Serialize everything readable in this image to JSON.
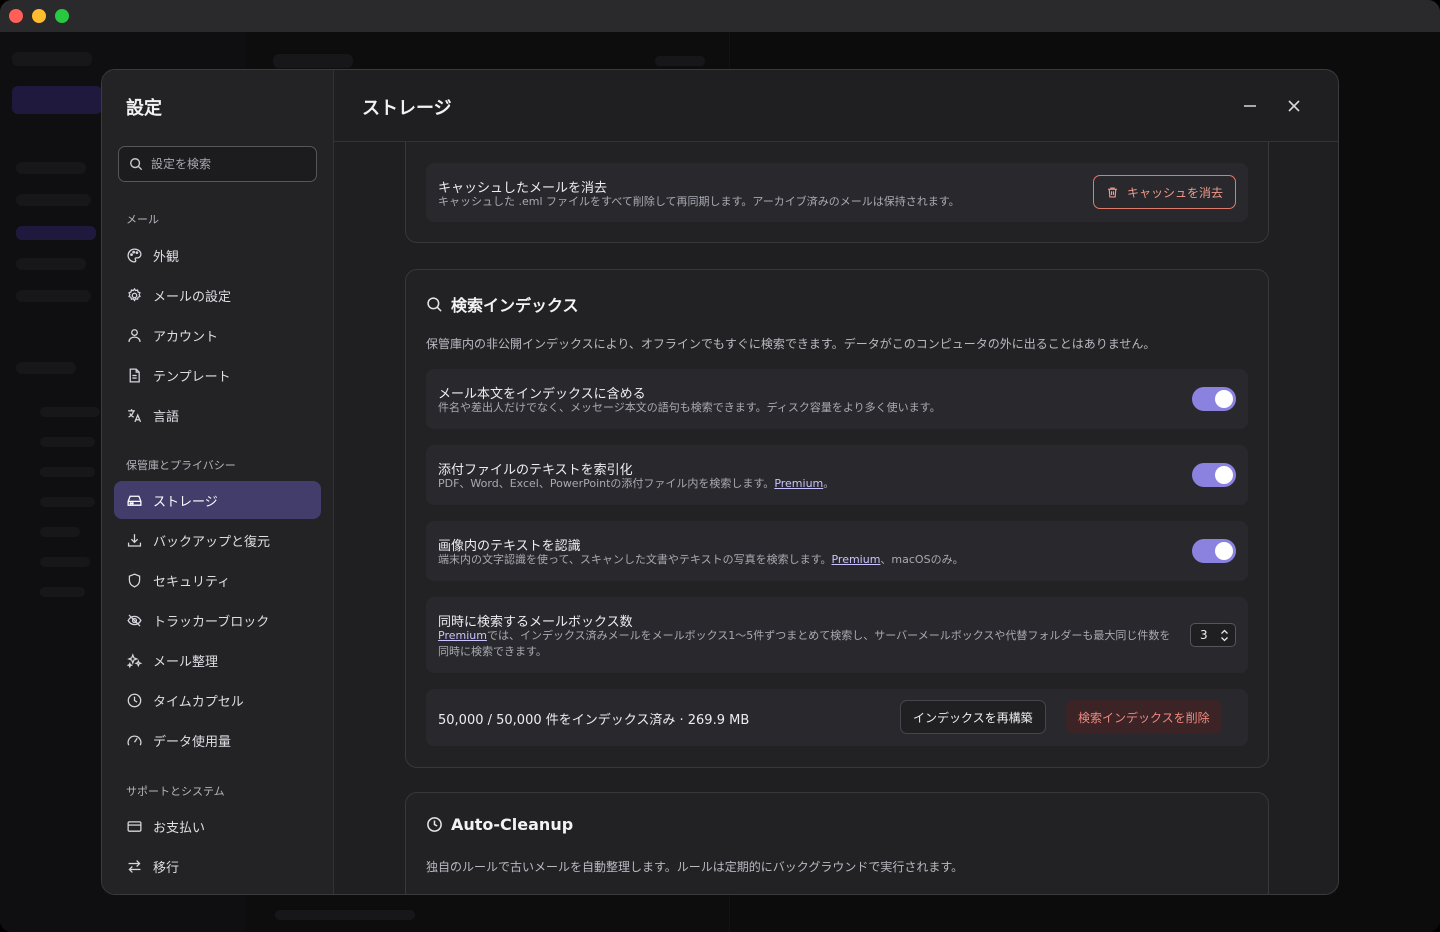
{
  "settings": {
    "title": "設定",
    "search_placeholder": "設定を検索",
    "groups": [
      {
        "label": "メール",
        "items": [
          {
            "label": "外観",
            "icon": "palette-icon"
          },
          {
            "label": "メールの設定",
            "icon": "gear-icon"
          },
          {
            "label": "アカウント",
            "icon": "user-icon"
          },
          {
            "label": "テンプレート",
            "icon": "document-icon"
          },
          {
            "label": "言語",
            "icon": "translate-icon"
          }
        ]
      },
      {
        "label": "保管庫とプライバシー",
        "items": [
          {
            "label": "ストレージ",
            "icon": "drive-icon",
            "active": true
          },
          {
            "label": "バックアップと復元",
            "icon": "download-icon"
          },
          {
            "label": "セキュリティ",
            "icon": "shield-icon"
          },
          {
            "label": "トラッカーブロック",
            "icon": "eye-off-icon"
          },
          {
            "label": "メール整理",
            "icon": "sparkles-icon"
          },
          {
            "label": "タイムカプセル",
            "icon": "clock-icon"
          },
          {
            "label": "データ使用量",
            "icon": "gauge-icon"
          }
        ]
      },
      {
        "label": "サポートとシステム",
        "items": [
          {
            "label": "お支払い",
            "icon": "credit-card-icon"
          },
          {
            "label": "移行",
            "icon": "arrows-swap-icon"
          }
        ]
      }
    ]
  },
  "main": {
    "title": "ストレージ",
    "cache": {
      "title": "キャッシュしたメールを消去",
      "desc": "キャッシュした .eml ファイルをすべて削除して再同期します。アーカイブ済みのメールは保持されます。",
      "button": "キャッシュを消去"
    },
    "search_index": {
      "title": "検索インデックス",
      "desc": "保管庫内の非公開インデックスにより、オフラインでもすぐに検索できます。データがこのコンピュータの外に出ることはありません。",
      "rows": [
        {
          "title": "メール本文をインデックスに含める",
          "desc": "件名や差出人だけでなく、メッセージ本文の語句も検索できます。ディスク容量をより多く使います。",
          "enabled": true
        },
        {
          "title": "添付ファイルのテキストを索引化",
          "desc_before": "PDF、Word、Excel、PowerPointの添付ファイル内を検索します。",
          "link": "Premium",
          "desc_after": "。",
          "enabled": true
        },
        {
          "title": "画像内のテキストを認識",
          "desc_before": "端末内の文字認識を使って、スキャンした文書やテキストの写真を検索します。",
          "link": "Premium",
          "desc_after": "、macOSのみ。",
          "enabled": true
        }
      ],
      "concurrency": {
        "title": "同時に検索するメールボックス数",
        "link": "Premium",
        "desc": "では、インデックス済みメールをメールボックス1〜5件ずつまとめて検索し、サーバーメールボックスや代替フォルダーも最大同じ件数を同時に検索できます。",
        "value": "3"
      },
      "status": "50,000 / 50,000 件をインデックス済み · 269.9 MB",
      "rebuild_button": "インデックスを再構築",
      "delete_button": "検索インデックスを削除"
    },
    "auto_cleanup": {
      "title": "Auto-Cleanup",
      "desc": "独自のルールで古いメールを自動整理します。ルールは定期的にバックグラウンドで実行されます。"
    }
  },
  "colors": {
    "accent": "#8b82e0",
    "active_nav": "#433d6b",
    "danger": "#f09a8a"
  }
}
